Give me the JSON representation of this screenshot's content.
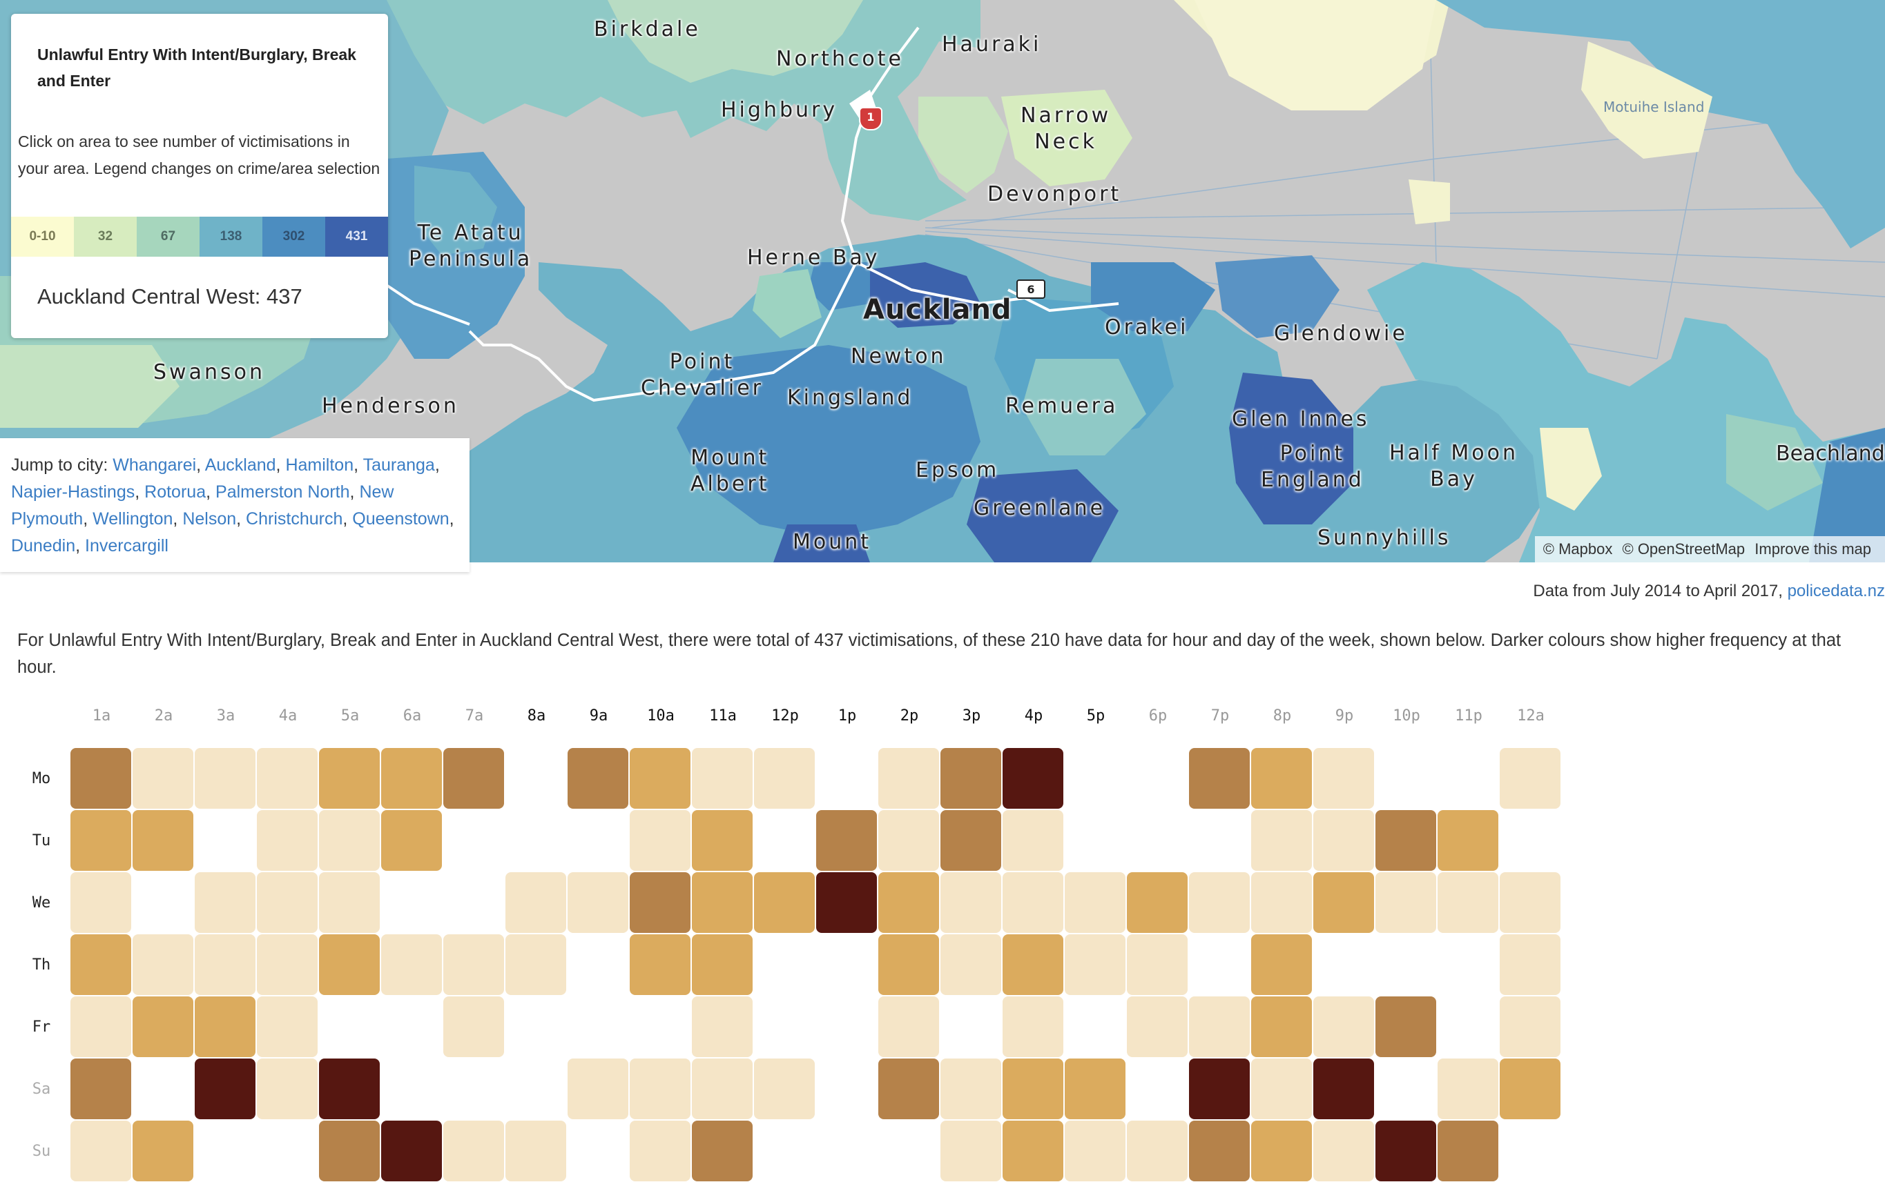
{
  "map": {
    "places": [
      {
        "id": "birkdale",
        "text": "Birkdale"
      },
      {
        "id": "northcote",
        "text": "Northcote"
      },
      {
        "id": "hauraki",
        "text": "Hauraki"
      },
      {
        "id": "highbury",
        "text": "Highbury"
      },
      {
        "id": "narrow-neck",
        "text": "Narrow\nNeck"
      },
      {
        "id": "devonport",
        "text": "Devonport"
      },
      {
        "id": "te-atatu",
        "text": "Te Atatu\nPeninsula"
      },
      {
        "id": "herne-bay",
        "text": "Herne Bay"
      },
      {
        "id": "auckland",
        "text": "Auckland"
      },
      {
        "id": "newton",
        "text": "Newton"
      },
      {
        "id": "orakei",
        "text": "Orakei"
      },
      {
        "id": "glendowie",
        "text": "Glendowie"
      },
      {
        "id": "swanson",
        "text": "Swanson"
      },
      {
        "id": "henderson",
        "text": "Henderson"
      },
      {
        "id": "point-chevalier",
        "text": "Point\nChevalier"
      },
      {
        "id": "kingsland",
        "text": "Kingsland"
      },
      {
        "id": "remuera",
        "text": "Remuera"
      },
      {
        "id": "glen-innes",
        "text": "Glen Innes"
      },
      {
        "id": "point-england",
        "text": "Point\nEngland"
      },
      {
        "id": "half-moon-bay",
        "text": "Half Moon\nBay"
      },
      {
        "id": "beachlands",
        "text": "Beachlands"
      },
      {
        "id": "mount-albert",
        "text": "Mount\nAlbert"
      },
      {
        "id": "epsom",
        "text": "Epsom"
      },
      {
        "id": "greenlane",
        "text": "Greenlane"
      },
      {
        "id": "mount-roskill",
        "text": "Mount"
      },
      {
        "id": "sunnyhills",
        "text": "Sunnyhills"
      },
      {
        "id": "motuihe",
        "text": "Motuihe Island"
      }
    ],
    "shields": {
      "red": "1",
      "white": "6"
    },
    "attribution": {
      "mapbox": "© Mapbox",
      "osm": "© OpenStreetMap",
      "improve": "Improve this map"
    }
  },
  "info": {
    "title": "Unlawful Entry With Intent/Burglary, Break and Enter",
    "description": "Click on area to see number of victimisations in your area. Legend changes on crime/area selection",
    "legend": [
      {
        "label": "0-10",
        "color": "#fbfbd0",
        "text": "#7a7a55"
      },
      {
        "label": "32",
        "color": "#d7ecbf",
        "text": "#6b7c5a"
      },
      {
        "label": "67",
        "color": "#a6d6bd",
        "text": "#4f6b63"
      },
      {
        "label": "138",
        "color": "#6fb3c8",
        "text": "#3c5f72"
      },
      {
        "label": "302",
        "color": "#4c8dc0",
        "text": "#2f4f6f"
      },
      {
        "label": "431",
        "color": "#3c62ac",
        "text": "#dfe6f5"
      }
    ],
    "value_text": "Auckland Central West: 437"
  },
  "jump": {
    "prefix": "Jump to city: ",
    "cities": [
      "Whangarei",
      "Auckland",
      "Hamilton",
      "Tauranga",
      "Napier-Hastings",
      "Rotorua",
      "Palmerston North",
      "New Plymouth",
      "Wellington",
      "Nelson",
      "Christchurch",
      "Queenstown",
      "Dunedin",
      "Invercargill"
    ]
  },
  "source": {
    "text": "Data from July 2014 to April 2017, ",
    "link": "policedata.nz"
  },
  "summary": "For Unlawful Entry With Intent/Burglary, Break and Enter in Auckland Central West, there were total of 437 victimisations, of these 210 have data for hour and day of the week, shown below. Darker colours show higher frequency at that hour.",
  "heatmap": {
    "hours": [
      "1a",
      "2a",
      "3a",
      "4a",
      "5a",
      "6a",
      "7a",
      "8a",
      "9a",
      "10a",
      "11a",
      "12p",
      "1p",
      "2p",
      "3p",
      "4p",
      "5p",
      "6p",
      "7p",
      "8p",
      "9p",
      "10p",
      "11p",
      "12a"
    ],
    "hours_dark": [
      false,
      false,
      false,
      false,
      false,
      false,
      false,
      true,
      true,
      true,
      true,
      true,
      true,
      true,
      true,
      true,
      true,
      false,
      false,
      false,
      false,
      false,
      false,
      false
    ],
    "days": [
      "Mo",
      "Tu",
      "We",
      "Th",
      "Fr",
      "Sa",
      "Su"
    ],
    "days_dark": [
      true,
      true,
      true,
      true,
      true,
      false,
      false
    ],
    "levels": [
      "#ffffff",
      "#f5e5c7",
      "#dbab5e",
      "#b5824a",
      "#561711"
    ],
    "values": [
      [
        3,
        1,
        1,
        1,
        2,
        2,
        3,
        0,
        3,
        2,
        1,
        1,
        0,
        1,
        3,
        4,
        0,
        0,
        3,
        2,
        1,
        0,
        0,
        1
      ],
      [
        2,
        2,
        0,
        1,
        1,
        2,
        0,
        0,
        0,
        1,
        2,
        0,
        3,
        1,
        3,
        1,
        0,
        0,
        0,
        1,
        1,
        3,
        2,
        0
      ],
      [
        1,
        0,
        1,
        1,
        1,
        0,
        0,
        1,
        1,
        3,
        2,
        2,
        4,
        2,
        1,
        1,
        1,
        2,
        1,
        1,
        2,
        1,
        1,
        1
      ],
      [
        2,
        1,
        1,
        1,
        2,
        1,
        1,
        1,
        0,
        2,
        2,
        0,
        0,
        2,
        1,
        2,
        1,
        1,
        0,
        2,
        0,
        0,
        0,
        1
      ],
      [
        1,
        2,
        2,
        1,
        0,
        0,
        1,
        0,
        0,
        0,
        1,
        0,
        0,
        1,
        0,
        1,
        0,
        1,
        1,
        2,
        1,
        3,
        0,
        1
      ],
      [
        3,
        0,
        4,
        1,
        4,
        0,
        0,
        0,
        1,
        1,
        1,
        1,
        0,
        3,
        1,
        2,
        2,
        0,
        4,
        1,
        4,
        0,
        1,
        2
      ],
      [
        1,
        2,
        0,
        0,
        3,
        4,
        1,
        1,
        0,
        1,
        3,
        0,
        0,
        0,
        1,
        2,
        1,
        1,
        3,
        2,
        1,
        4,
        3,
        0
      ]
    ]
  }
}
